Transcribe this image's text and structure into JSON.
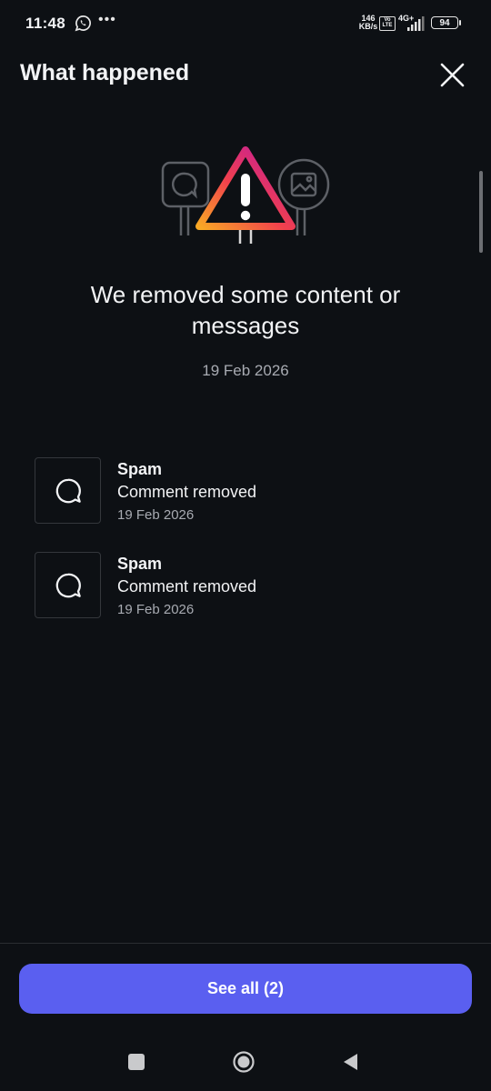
{
  "status_bar": {
    "time": "11:48",
    "speed_value": "146",
    "speed_unit": "KB/s",
    "volte": "Vo LTE",
    "network": "4G+",
    "battery": "94",
    "icons": [
      "whatsapp-icon",
      "more-dots-icon",
      "signal-icon",
      "battery-icon"
    ]
  },
  "header": {
    "title": "What happened",
    "close_icon": "close-icon"
  },
  "summary": {
    "headline": "We removed some content or messages",
    "date": "19 Feb 2026",
    "illustration_icons": [
      "chat-bubble-sign",
      "warning-triangle-icon",
      "image-sign"
    ]
  },
  "items": [
    {
      "title": "Spam",
      "subtitle": "Comment removed",
      "date": "19 Feb 2026",
      "icon": "comment-icon"
    },
    {
      "title": "Spam",
      "subtitle": "Comment removed",
      "date": "19 Feb 2026",
      "icon": "comment-icon"
    }
  ],
  "footer": {
    "see_all_label": "See all (2)"
  },
  "colors": {
    "background": "#0d1014",
    "primary_button": "#5a5ff0",
    "secondary_text": "#a8abb2",
    "warning_gradient": [
      "#f9a825",
      "#e1306c",
      "#833ab4"
    ]
  }
}
